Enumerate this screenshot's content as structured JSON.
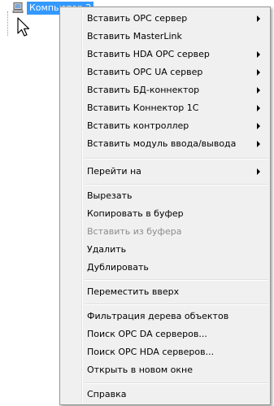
{
  "tree": {
    "node_label": "Компьютер 2",
    "node_icon": "computer-icon"
  },
  "cursor_icon": "mouse-pointer-icon",
  "context_menu": {
    "group1": [
      {
        "label": "Вставить OPC сервер",
        "submenu": true
      },
      {
        "label": "Вставить MasterLink",
        "submenu": false
      },
      {
        "label": "Вставить HDA OPC сервер",
        "submenu": true
      },
      {
        "label": "Вставить OPC UA сервер",
        "submenu": true
      },
      {
        "label": "Вставить БД-коннектор",
        "submenu": true
      },
      {
        "label": "Вставить Коннектор 1С",
        "submenu": true
      },
      {
        "label": "Вставить контроллер",
        "submenu": true
      },
      {
        "label": "Вставить модуль ввода/вывода",
        "submenu": true
      }
    ],
    "group2": [
      {
        "label": "Перейти на",
        "submenu": true
      }
    ],
    "group3": [
      {
        "label": "Вырезать",
        "enabled": true
      },
      {
        "label": "Копировать в буфер",
        "enabled": true
      },
      {
        "label": "Вставить из буфера",
        "enabled": false
      },
      {
        "label": "Удалить",
        "enabled": true
      },
      {
        "label": "Дублировать",
        "enabled": true
      }
    ],
    "group4": [
      {
        "label": "Переместить вверх"
      }
    ],
    "group5": [
      {
        "label": "Фильтрация дерева объектов"
      },
      {
        "label": "Поиск OPC DA серверов..."
      },
      {
        "label": "Поиск OPC HDA серверов..."
      },
      {
        "label": "Открыть в новом окне"
      }
    ],
    "group6": [
      {
        "label": "Справка"
      }
    ],
    "submenu_arrow_icon": "chevron-right-icon"
  }
}
